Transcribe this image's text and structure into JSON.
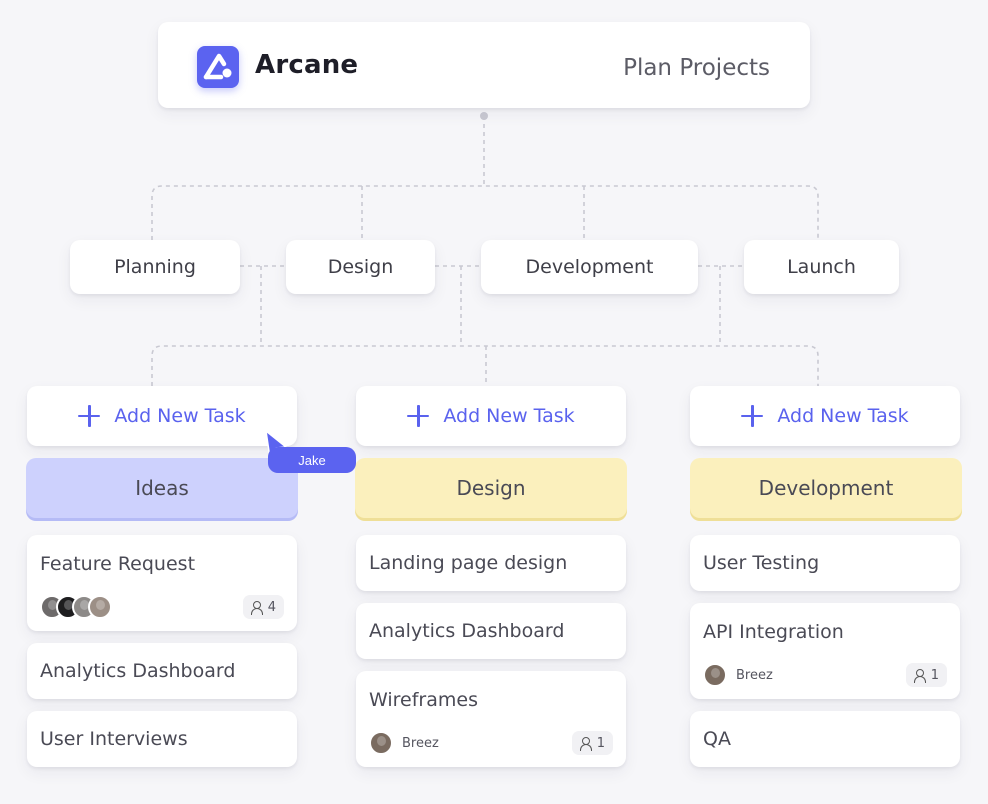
{
  "header": {
    "brand": "Arcane",
    "subtitle": "Plan Projects"
  },
  "stages": [
    "Planning",
    "Design",
    "Development",
    "Launch"
  ],
  "add_task_label": "Add New Task",
  "cursor": {
    "user": "Jake"
  },
  "columns": [
    {
      "title": "Ideas",
      "tasks": [
        {
          "title": "Feature Request",
          "avatars": 4,
          "count": "4"
        },
        {
          "title": "Analytics Dashboard"
        },
        {
          "title": "User Interviews"
        }
      ]
    },
    {
      "title": "Design",
      "tasks": [
        {
          "title": "Landing page design"
        },
        {
          "title": "Analytics Dashboard"
        },
        {
          "title": "Wireframes",
          "owner": "Breez",
          "count": "1"
        }
      ]
    },
    {
      "title": "Development",
      "tasks": [
        {
          "title": "User Testing"
        },
        {
          "title": "API Integration",
          "owner": "Breez",
          "count": "1"
        },
        {
          "title": "QA"
        }
      ]
    }
  ],
  "colors": {
    "accent": "#5b63f0",
    "ideas_header": "#cdd1fd",
    "stage_header": "#fbf0bd",
    "background": "#f6f6f9"
  },
  "icons": [
    "arcane-logo-icon",
    "plus-icon",
    "person-icon",
    "cursor-pointer-icon"
  ]
}
